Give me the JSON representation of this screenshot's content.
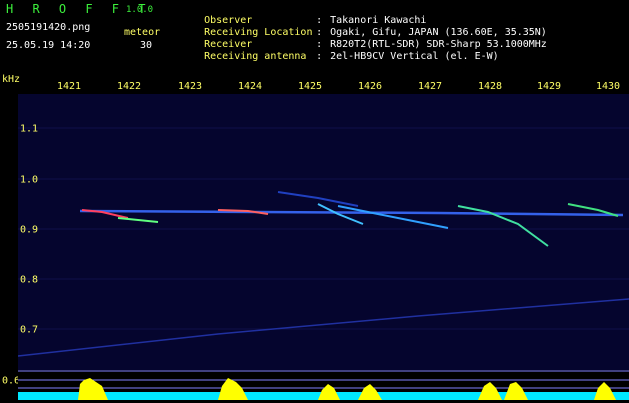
{
  "app": {
    "title": "H R O F F T",
    "version": "1.0.0",
    "file_name": "2505191420.png",
    "timestamp": "25.05.19 14:20",
    "meteor_label": "meteor",
    "meteor_count": "30"
  },
  "info": [
    {
      "label": "Observer",
      "value": "Takanori Kawachi"
    },
    {
      "label": "Receiving Location",
      "value": "Ogaki, Gifu, JAPAN (136.60E, 35.35N)"
    },
    {
      "label": "Receiver",
      "value": "R820T2(RTL-SDR) SDR-Sharp 53.1000MHz"
    },
    {
      "label": "Receiving antenna",
      "value": "2el-HB9CV Vertical (el. E-W)"
    }
  ],
  "axes": {
    "unit": "kHz",
    "x_ticks": [
      "1421",
      "1422",
      "1423",
      "1424",
      "1425",
      "1426",
      "1427",
      "1428",
      "1429",
      "1430"
    ],
    "y_ticks": [
      "1.1",
      "1.0",
      "0.9",
      "0.8",
      "0.7",
      "0.6"
    ]
  },
  "colors": {
    "accent_green": "#3cf03c",
    "label_yellow": "#ffff66",
    "background_blue": "#05052e",
    "signal_yellow": "#ffff00",
    "signal_cyan": "#00e8ff"
  }
}
